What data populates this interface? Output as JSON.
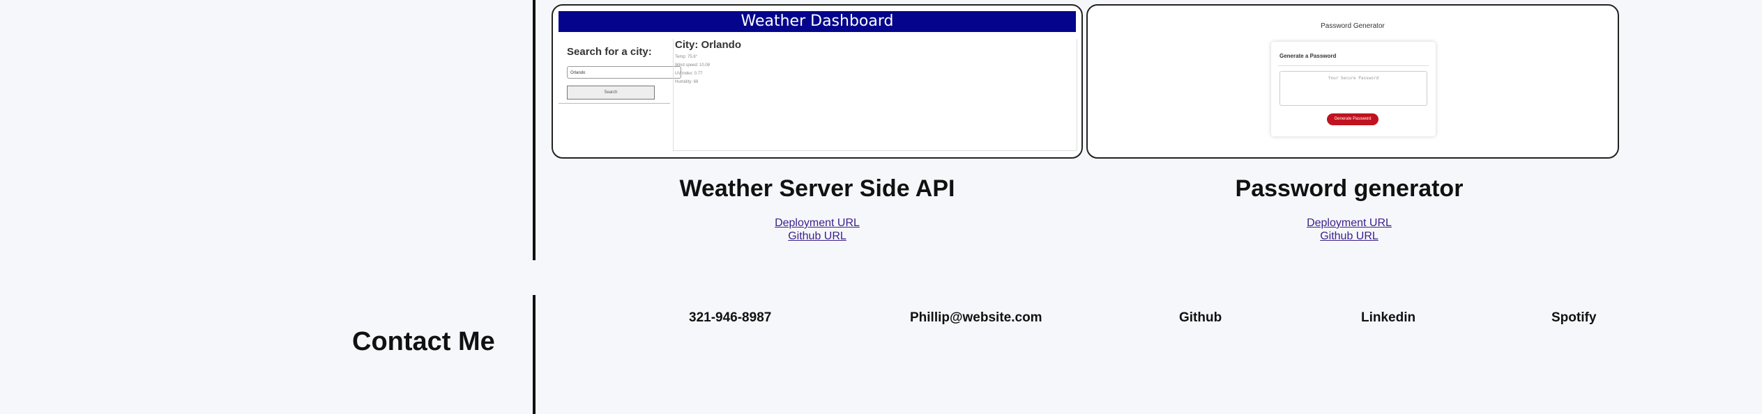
{
  "projects": [
    {
      "title": "Weather Server Side API",
      "deployment_label": "Deployment URL",
      "github_label": "Github URL",
      "preview": {
        "header": "Weather Dashboard",
        "search_heading": "Search for a city:",
        "search_value": "Orlando",
        "search_button": "Search",
        "city": "City: Orlando",
        "details": [
          "Temp: 75.6°",
          "Wind speed: 10.08",
          "UV index: 0.77",
          "Humidity: 68"
        ]
      }
    },
    {
      "title": "Password generator",
      "deployment_label": "Deployment URL",
      "github_label": "Github URL",
      "preview": {
        "page_title": "Password Generator",
        "card_heading": "Generate a Password",
        "placeholder": "Your Secure Password",
        "button": "Generate Password"
      }
    }
  ],
  "contact": {
    "heading": "Contact Me",
    "items": [
      "321-946-8987",
      "Phillip@website.com",
      "Github",
      "Linkedin",
      "Spotify"
    ]
  },
  "colors": {
    "background": "#f6f7fb",
    "link": "#3a1f8a",
    "weather_header": "#04048c",
    "password_button": "#c1121f"
  }
}
